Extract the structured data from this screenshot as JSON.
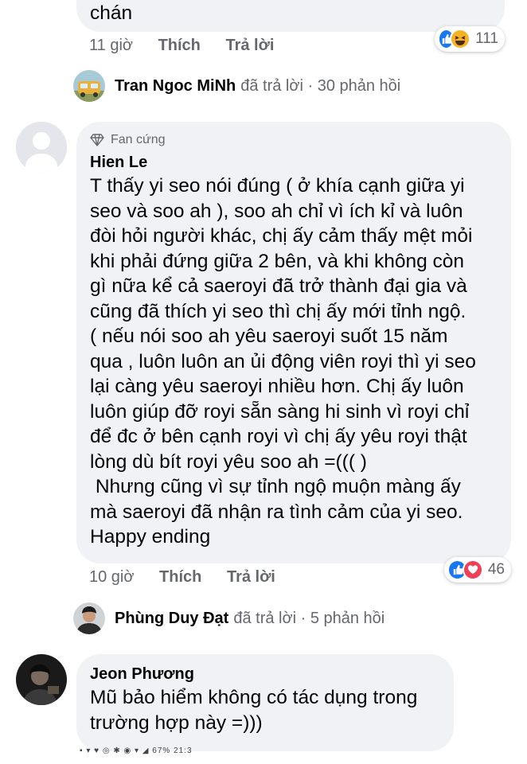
{
  "comment1": {
    "text_tail": "chán",
    "time": "11 giờ",
    "like_label": "Thích",
    "reply_label": "Trả lời",
    "reaction_icons": [
      "like-icon",
      "haha-icon"
    ],
    "reaction_count": "111"
  },
  "reply_summary1": {
    "name": "Tran Ngoc MiNh",
    "text": "đã trả lời · 30 phản hồi"
  },
  "comment2": {
    "badge": "Fan cứng",
    "author": "Hien Le",
    "text": "T thấy yi seo nói đúng ( ở khía cạnh giữa yi\nseo và soo ah ), soo ah chỉ vì ích kỉ và luôn\nđòi hỏi người khác, chị ấy cảm thấy mệt mỏi\nkhi phải đứng giữa 2 bên, và khi không còn\ngì nữa kể cả saeroyi đã trở thành đại gia và\ncũng đã thích yi seo thì chị ấy mới tỉnh ngộ.\n( nếu nói soo ah yêu saeroyi suốt 15 năm\nqua , luôn luôn an ủi động viên royi thì yi seo\nlại càng yêu saeroyi nhiều hơn. Chị ấy luôn\nluôn giúp đỡ royi sẵn sàng hi sinh vì royi chỉ\nđể đc ở bên cạnh royi vì chị ấy yêu royi thật\nlòng dù bít royi yêu soo ah =((( )\n Nhưng cũng vì sự tỉnh ngộ muộn màng ấy\nmà saeroyi đã nhận ra tình cảm của yi seo.\nHappy ending",
    "time": "10 giờ",
    "like_label": "Thích",
    "reply_label": "Trả lời",
    "reaction_icons": [
      "like-icon",
      "love-icon"
    ],
    "reaction_count": "46"
  },
  "reply_summary2": {
    "name": "Phùng Duy Đạt",
    "text": "đã trả lời · 5 phản hồi"
  },
  "comment3": {
    "author": "Jeon Phương",
    "text": "Mũ bảo hiểm không có tác dụng trong\ntrường hợp này =)))"
  },
  "statusbar": {
    "text": "▪ ▾ ♥ ◎ ✱  ◉ ▾ ◢ 67% 21:3"
  },
  "colors": {
    "bubble": "#f0f2f5",
    "secondary_text": "#65676b",
    "like_blue": "#1877f2",
    "love_red": "#f33e58",
    "haha_yellow": "#f7b125"
  }
}
